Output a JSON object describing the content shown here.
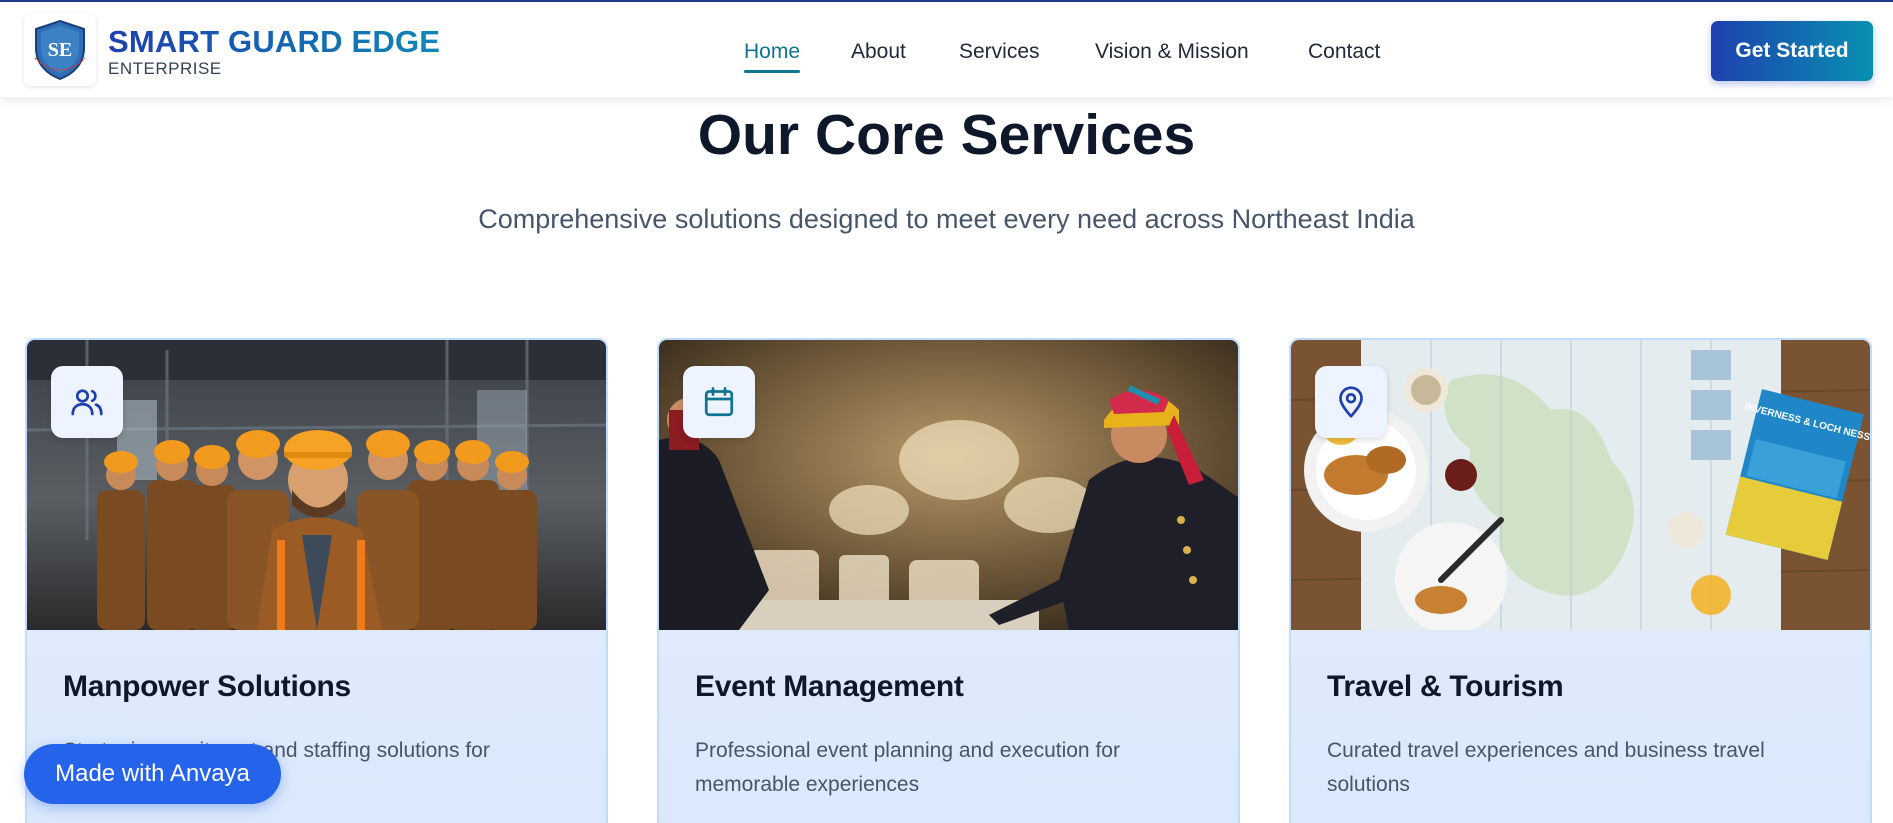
{
  "brand": {
    "logo_text": "SE",
    "name": "SMART GUARD EDGE",
    "subtitle": "ENTERPRISE"
  },
  "nav": {
    "items": [
      {
        "label": "Home",
        "active": true
      },
      {
        "label": "About",
        "active": false
      },
      {
        "label": "Services",
        "active": false
      },
      {
        "label": "Vision & Mission",
        "active": false
      },
      {
        "label": "Contact",
        "active": false
      }
    ],
    "cta_label": "Get Started"
  },
  "section": {
    "title": "Our Core Services",
    "subtitle": "Comprehensive solutions designed to meet every need across Northeast India"
  },
  "cards": [
    {
      "icon": "users-icon",
      "title": "Manpower Solutions",
      "description": "Strategic recruitment and staffing solutions for"
    },
    {
      "icon": "calendar-icon",
      "title": "Event Management",
      "description": "Professional event planning and execution for memorable experiences"
    },
    {
      "icon": "map-pin-icon",
      "title": "Travel & Tourism",
      "description": "Curated travel experiences and business travel solutions"
    }
  ],
  "travel_book_text": "INVERNESS & LOCH NESS",
  "floating_badge": {
    "label": "Made with Anvaya"
  },
  "colors": {
    "brand_primary": "#1e40af",
    "brand_accent": "#0e7490",
    "card_bg": "#e5efff",
    "card_border": "#bfdbfe"
  }
}
